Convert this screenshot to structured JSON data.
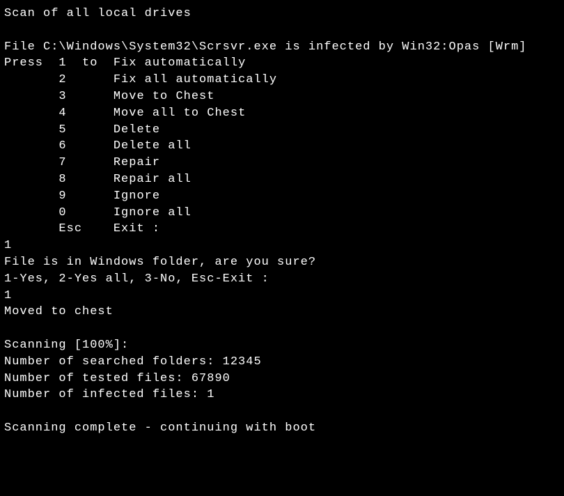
{
  "title": "Scan of all local drives",
  "infection_msg": "File C:\\Windows\\System32\\Scrsvr.exe is infected by Win32:Opas [Wrm]",
  "menu": {
    "press_prefix": "Press",
    "to_word": "to",
    "items": [
      {
        "key": "1",
        "label": "Fix automatically"
      },
      {
        "key": "2",
        "label": "Fix all automatically"
      },
      {
        "key": "3",
        "label": "Move to Chest"
      },
      {
        "key": "4",
        "label": "Move all to Chest"
      },
      {
        "key": "5",
        "label": "Delete"
      },
      {
        "key": "6",
        "label": "Delete all"
      },
      {
        "key": "7",
        "label": "Repair"
      },
      {
        "key": "8",
        "label": "Repair all"
      },
      {
        "key": "9",
        "label": "Ignore"
      },
      {
        "key": "0",
        "label": "Ignore all"
      },
      {
        "key": "Esc",
        "label": "Exit :"
      }
    ]
  },
  "user_input_1": "1",
  "confirm_prompt": "File is in Windows folder, are you sure?",
  "confirm_options": "1-Yes, 2-Yes all, 3-No, Esc-Exit :",
  "user_input_2": "1",
  "action_result": "Moved to chest",
  "scanning_progress": "Scanning [100%]:",
  "stats": {
    "folders_label": "Number of searched folders:",
    "folders_value": "12345",
    "files_label": "Number of tested files:",
    "files_value": "67890",
    "infected_label": "Number of infected files:",
    "infected_value": "1"
  },
  "complete_msg": "Scanning complete - continuing with boot"
}
